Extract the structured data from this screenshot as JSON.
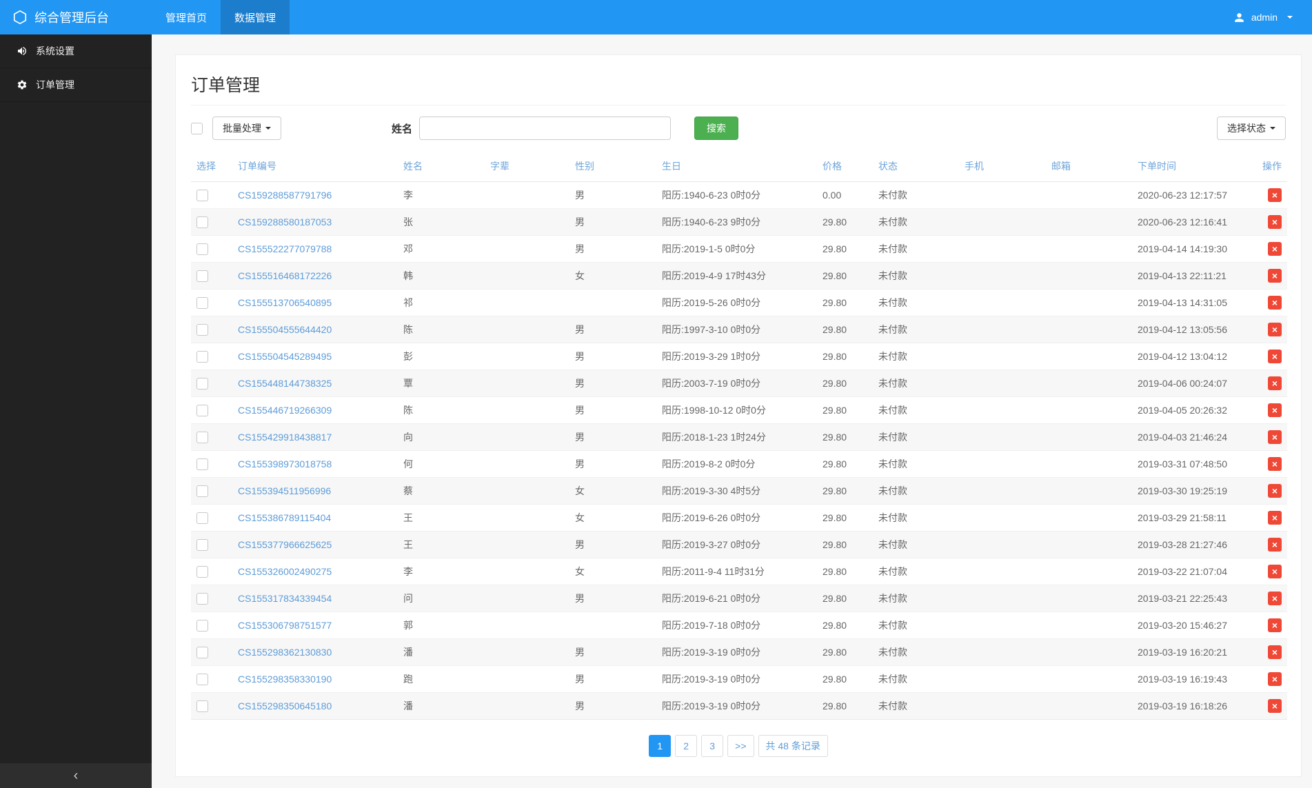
{
  "app": {
    "brand": "综合管理后台"
  },
  "topnav": {
    "items": [
      {
        "label": "管理首页",
        "active": false
      },
      {
        "label": "数据管理",
        "active": true
      }
    ],
    "user": "admin"
  },
  "sidebar": {
    "items": [
      {
        "label": "系统设置",
        "icon": "speaker-icon"
      },
      {
        "label": "订单管理",
        "icon": "gear-icon"
      }
    ],
    "collapse_glyph": "‹"
  },
  "page": {
    "title": "订单管理"
  },
  "toolbar": {
    "batch_label": "批量处理",
    "name_label": "姓名",
    "name_value": "",
    "search_label": "搜索",
    "status_label": "选择状态"
  },
  "table": {
    "headers": [
      "选择",
      "订单编号",
      "姓名",
      "字辈",
      "性别",
      "生日",
      "价格",
      "状态",
      "手机",
      "邮箱",
      "下单时间",
      "操作"
    ],
    "rows": [
      {
        "order_no": "CS159288587791796",
        "name": "李",
        "zibei": "",
        "gender": "男",
        "birthday": "阳历:1940-6-23 0时0分",
        "price": "0.00",
        "status": "未付款",
        "phone": "",
        "email": "",
        "order_time": "2020-06-23 12:17:57"
      },
      {
        "order_no": "CS159288580187053",
        "name": "张",
        "zibei": "",
        "gender": "男",
        "birthday": "阳历:1940-6-23 9时0分",
        "price": "29.80",
        "status": "未付款",
        "phone": "",
        "email": "",
        "order_time": "2020-06-23 12:16:41"
      },
      {
        "order_no": "CS155522277079788",
        "name": "邓",
        "zibei": "",
        "gender": "男",
        "birthday": "阳历:2019-1-5 0时0分",
        "price": "29.80",
        "status": "未付款",
        "phone": "",
        "email": "",
        "order_time": "2019-04-14 14:19:30"
      },
      {
        "order_no": "CS155516468172226",
        "name": "韩",
        "zibei": "",
        "gender": "女",
        "birthday": "阳历:2019-4-9 17时43分",
        "price": "29.80",
        "status": "未付款",
        "phone": "",
        "email": "",
        "order_time": "2019-04-13 22:11:21"
      },
      {
        "order_no": "CS155513706540895",
        "name": "祁",
        "zibei": "",
        "gender": "",
        "birthday": "阳历:2019-5-26 0时0分",
        "price": "29.80",
        "status": "未付款",
        "phone": "",
        "email": "",
        "order_time": "2019-04-13 14:31:05"
      },
      {
        "order_no": "CS155504555644420",
        "name": "陈",
        "zibei": "",
        "gender": "男",
        "birthday": "阳历:1997-3-10 0时0分",
        "price": "29.80",
        "status": "未付款",
        "phone": "",
        "email": "",
        "order_time": "2019-04-12 13:05:56"
      },
      {
        "order_no": "CS155504545289495",
        "name": "彭",
        "zibei": "",
        "gender": "男",
        "birthday": "阳历:2019-3-29 1时0分",
        "price": "29.80",
        "status": "未付款",
        "phone": "",
        "email": "",
        "order_time": "2019-04-12 13:04:12"
      },
      {
        "order_no": "CS155448144738325",
        "name": "覃",
        "zibei": "",
        "gender": "男",
        "birthday": "阳历:2003-7-19 0时0分",
        "price": "29.80",
        "status": "未付款",
        "phone": "",
        "email": "",
        "order_time": "2019-04-06 00:24:07"
      },
      {
        "order_no": "CS155446719266309",
        "name": "陈",
        "zibei": "",
        "gender": "男",
        "birthday": "阳历:1998-10-12 0时0分",
        "price": "29.80",
        "status": "未付款",
        "phone": "",
        "email": "",
        "order_time": "2019-04-05 20:26:32"
      },
      {
        "order_no": "CS155429918438817",
        "name": "向",
        "zibei": "",
        "gender": "男",
        "birthday": "阳历:2018-1-23 1时24分",
        "price": "29.80",
        "status": "未付款",
        "phone": "",
        "email": "",
        "order_time": "2019-04-03 21:46:24"
      },
      {
        "order_no": "CS155398973018758",
        "name": "何",
        "zibei": "",
        "gender": "男",
        "birthday": "阳历:2019-8-2 0时0分",
        "price": "29.80",
        "status": "未付款",
        "phone": "",
        "email": "",
        "order_time": "2019-03-31 07:48:50"
      },
      {
        "order_no": "CS155394511956996",
        "name": "蔡",
        "zibei": "",
        "gender": "女",
        "birthday": "阳历:2019-3-30 4时5分",
        "price": "29.80",
        "status": "未付款",
        "phone": "",
        "email": "",
        "order_time": "2019-03-30 19:25:19"
      },
      {
        "order_no": "CS155386789115404",
        "name": "王",
        "zibei": "",
        "gender": "女",
        "birthday": "阳历:2019-6-26 0时0分",
        "price": "29.80",
        "status": "未付款",
        "phone": "",
        "email": "",
        "order_time": "2019-03-29 21:58:11"
      },
      {
        "order_no": "CS155377966625625",
        "name": "王",
        "zibei": "",
        "gender": "男",
        "birthday": "阳历:2019-3-27 0时0分",
        "price": "29.80",
        "status": "未付款",
        "phone": "",
        "email": "",
        "order_time": "2019-03-28 21:27:46"
      },
      {
        "order_no": "CS155326002490275",
        "name": "李",
        "zibei": "",
        "gender": "女",
        "birthday": "阳历:2011-9-4 11时31分",
        "price": "29.80",
        "status": "未付款",
        "phone": "",
        "email": "",
        "order_time": "2019-03-22 21:07:04"
      },
      {
        "order_no": "CS155317834339454",
        "name": "问",
        "zibei": "",
        "gender": "男",
        "birthday": "阳历:2019-6-21 0时0分",
        "price": "29.80",
        "status": "未付款",
        "phone": "",
        "email": "",
        "order_time": "2019-03-21 22:25:43"
      },
      {
        "order_no": "CS155306798751577",
        "name": "郭",
        "zibei": "",
        "gender": "",
        "birthday": "阳历:2019-7-18 0时0分",
        "price": "29.80",
        "status": "未付款",
        "phone": "",
        "email": "",
        "order_time": "2019-03-20 15:46:27"
      },
      {
        "order_no": "CS155298362130830",
        "name": "潘",
        "zibei": "",
        "gender": "男",
        "birthday": "阳历:2019-3-19 0时0分",
        "price": "29.80",
        "status": "未付款",
        "phone": "",
        "email": "",
        "order_time": "2019-03-19 16:20:21"
      },
      {
        "order_no": "CS155298358330190",
        "name": "跑",
        "zibei": "",
        "gender": "男",
        "birthday": "阳历:2019-3-19 0时0分",
        "price": "29.80",
        "status": "未付款",
        "phone": "",
        "email": "",
        "order_time": "2019-03-19 16:19:43"
      },
      {
        "order_no": "CS155298350645180",
        "name": "潘",
        "zibei": "",
        "gender": "男",
        "birthday": "阳历:2019-3-19 0时0分",
        "price": "29.80",
        "status": "未付款",
        "phone": "",
        "email": "",
        "order_time": "2019-03-19 16:18:26"
      }
    ]
  },
  "pagination": {
    "pages": [
      "1",
      "2",
      "3",
      ">>"
    ],
    "active": "1",
    "total_text": "共 48 条记录"
  },
  "colors": {
    "topbar": "#2196f3",
    "sidebar": "#222222",
    "link": "#5e9cd8",
    "header_text": "#6fa5da",
    "success": "#4caf50",
    "danger": "#ef4836",
    "page_bg": "#f7f7f7"
  }
}
